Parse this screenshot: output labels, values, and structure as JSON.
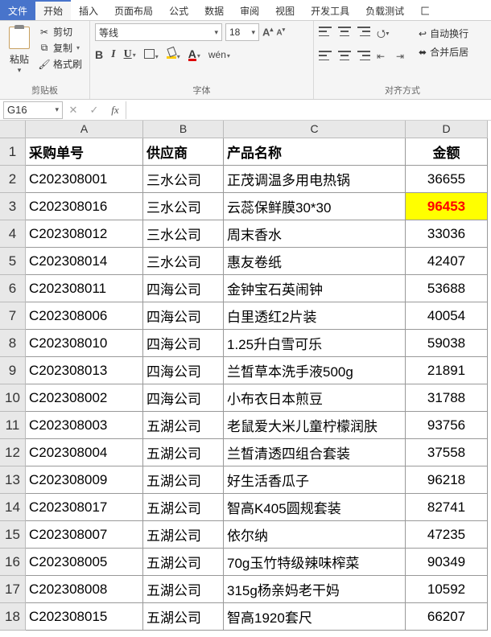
{
  "tabs": {
    "file": "文件",
    "home": "开始",
    "insert": "插入",
    "layout": "页面布局",
    "formula": "公式",
    "data": "数据",
    "review": "审阅",
    "view": "视图",
    "dev": "开发工具",
    "load": "负载测试",
    "extra": "匚"
  },
  "clipboard": {
    "paste": "粘贴",
    "cut": "剪切",
    "copy": "复制",
    "fmt": "格式刷",
    "group": "剪贴板"
  },
  "font": {
    "name": "等线",
    "size": "18",
    "bold": "B",
    "italic": "I",
    "underline": "U",
    "wen": "wén",
    "group": "字体"
  },
  "align": {
    "wrap": "自动换行",
    "merge": "合并后居",
    "group": "对齐方式"
  },
  "namebox": "G16",
  "fx": "fx",
  "columns": [
    "A",
    "B",
    "C",
    "D"
  ],
  "headers": [
    "采购单号",
    "供应商",
    "产品名称",
    "金额"
  ],
  "rows": [
    {
      "n": 1,
      "a": "采购单号",
      "b": "供应商",
      "c": "产品名称",
      "d": "金额",
      "isHeader": true
    },
    {
      "n": 2,
      "a": "C202308001",
      "b": "三水公司",
      "c": "正茂调温多用电热锅",
      "d": "36655"
    },
    {
      "n": 3,
      "a": "C202308016",
      "b": "三水公司",
      "c": "云蕊保鲜膜30*30",
      "d": "96453",
      "hl": true
    },
    {
      "n": 4,
      "a": "C202308012",
      "b": "三水公司",
      "c": "周末香水",
      "d": "33036"
    },
    {
      "n": 5,
      "a": "C202308014",
      "b": "三水公司",
      "c": "惠友卷纸",
      "d": "42407"
    },
    {
      "n": 6,
      "a": "C202308011",
      "b": "四海公司",
      "c": "金钟宝石英闹钟",
      "d": "53688"
    },
    {
      "n": 7,
      "a": "C202308006",
      "b": "四海公司",
      "c": "白里透红2片装",
      "d": "40054"
    },
    {
      "n": 8,
      "a": "C202308010",
      "b": "四海公司",
      "c": "1.25升白雪可乐",
      "d": "59038"
    },
    {
      "n": 9,
      "a": "C202308013",
      "b": "四海公司",
      "c": "兰皙草本洗手液500g",
      "d": "21891"
    },
    {
      "n": 10,
      "a": "C202308002",
      "b": "四海公司",
      "c": "小布衣日本煎豆",
      "d": "31788"
    },
    {
      "n": 11,
      "a": "C202308003",
      "b": "五湖公司",
      "c": "老鼠爱大米儿童柠檬润肤",
      "d": "93756"
    },
    {
      "n": 12,
      "a": "C202308004",
      "b": "五湖公司",
      "c": "兰皙清透四组合套装",
      "d": "37558"
    },
    {
      "n": 13,
      "a": "C202308009",
      "b": "五湖公司",
      "c": "好生活香瓜子",
      "d": "96218"
    },
    {
      "n": 14,
      "a": "C202308017",
      "b": "五湖公司",
      "c": "智高K405圆规套装",
      "d": "82741"
    },
    {
      "n": 15,
      "a": "C202308007",
      "b": "五湖公司",
      "c": "依尔纳",
      "d": "47235"
    },
    {
      "n": 16,
      "a": "C202308005",
      "b": "五湖公司",
      "c": "70g玉竹特级辣味榨菜",
      "d": "90349"
    },
    {
      "n": 17,
      "a": "C202308008",
      "b": "五湖公司",
      "c": "315g杨亲妈老干妈",
      "d": "10592"
    },
    {
      "n": 18,
      "a": "C202308015",
      "b": "五湖公司",
      "c": "智高1920套尺",
      "d": "66207"
    }
  ]
}
